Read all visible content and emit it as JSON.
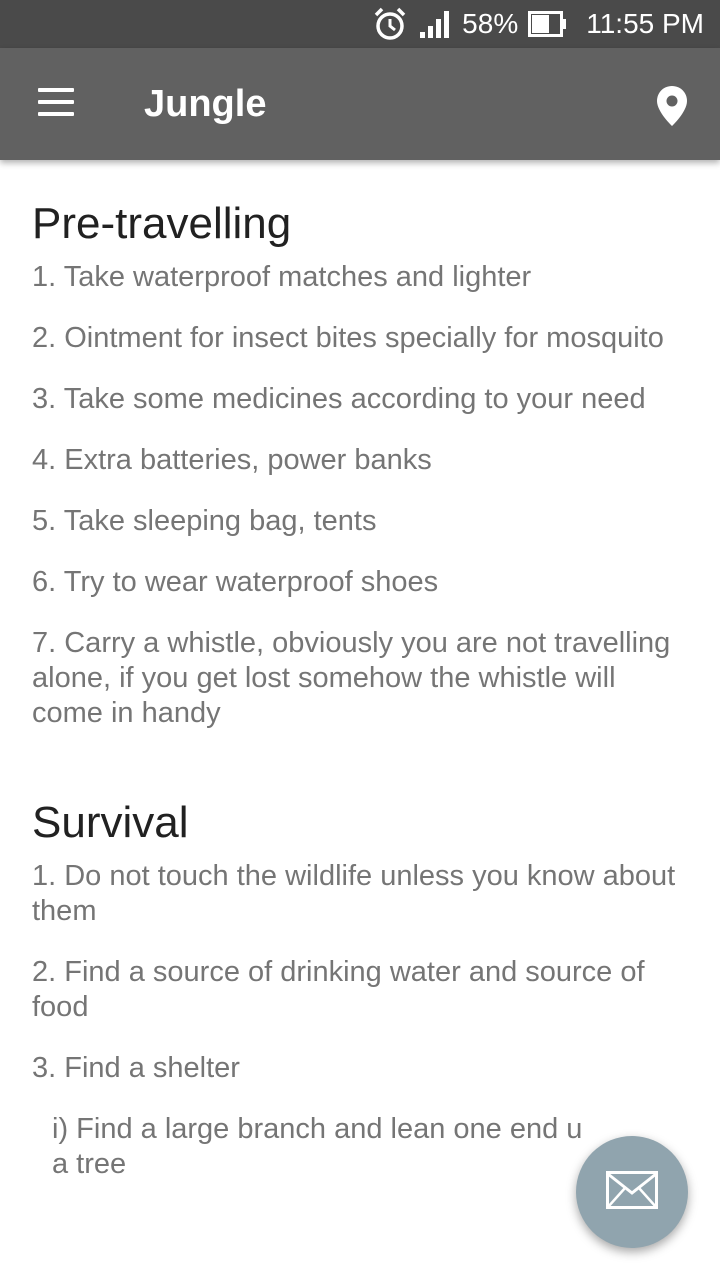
{
  "status_bar": {
    "battery_percent": "58%",
    "time": "11:55 PM",
    "icons": [
      "alarm-icon",
      "signal-icon",
      "battery-icon"
    ]
  },
  "app_bar": {
    "title": "Jungle",
    "menu_icon": "menu-icon",
    "action_icon": "location-pin-icon",
    "background_color": "#616161"
  },
  "sections": [
    {
      "title": "Pre-travelling",
      "items": [
        "1. Take waterproof matches and lighter",
        "2. Ointment for insect bites specially for mosquito",
        "3. Take some medicines according to your need",
        "4. Extra batteries, power banks",
        "5. Take sleeping bag, tents",
        "6. Try to wear waterproof shoes",
        "7. Carry a whistle, obviously you are not travelling alone, if you get lost somehow the whistle will come in handy"
      ]
    },
    {
      "title": "Survival",
      "items": [
        "1. Do not touch the wildlife unless you know about them",
        "2. Find a source of drinking water and source of food",
        "3. Find a shelter"
      ],
      "sub_items": [
        "i) Find a large branch and lean one end u",
        "a tree"
      ]
    }
  ],
  "fab": {
    "icon": "mail-icon",
    "color": "#90a4ae"
  }
}
